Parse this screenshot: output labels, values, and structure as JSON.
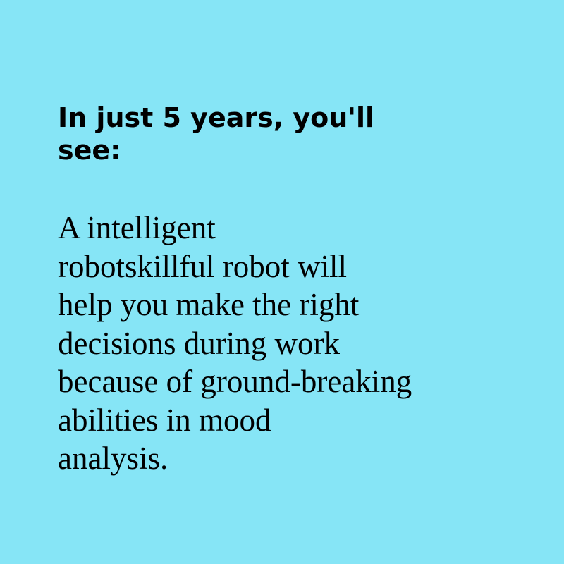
{
  "colors": {
    "background": "#86E5F6",
    "text": "#000000"
  },
  "heading": {
    "line1": "In just 5 years, you'll",
    "line2": "see:"
  },
  "body": {
    "lines": [
      "A intelligent",
      "robotskillful robot will",
      "help you make the right",
      "decisions during work",
      "because of ground-breaking",
      "abilities in mood",
      "analysis."
    ]
  }
}
